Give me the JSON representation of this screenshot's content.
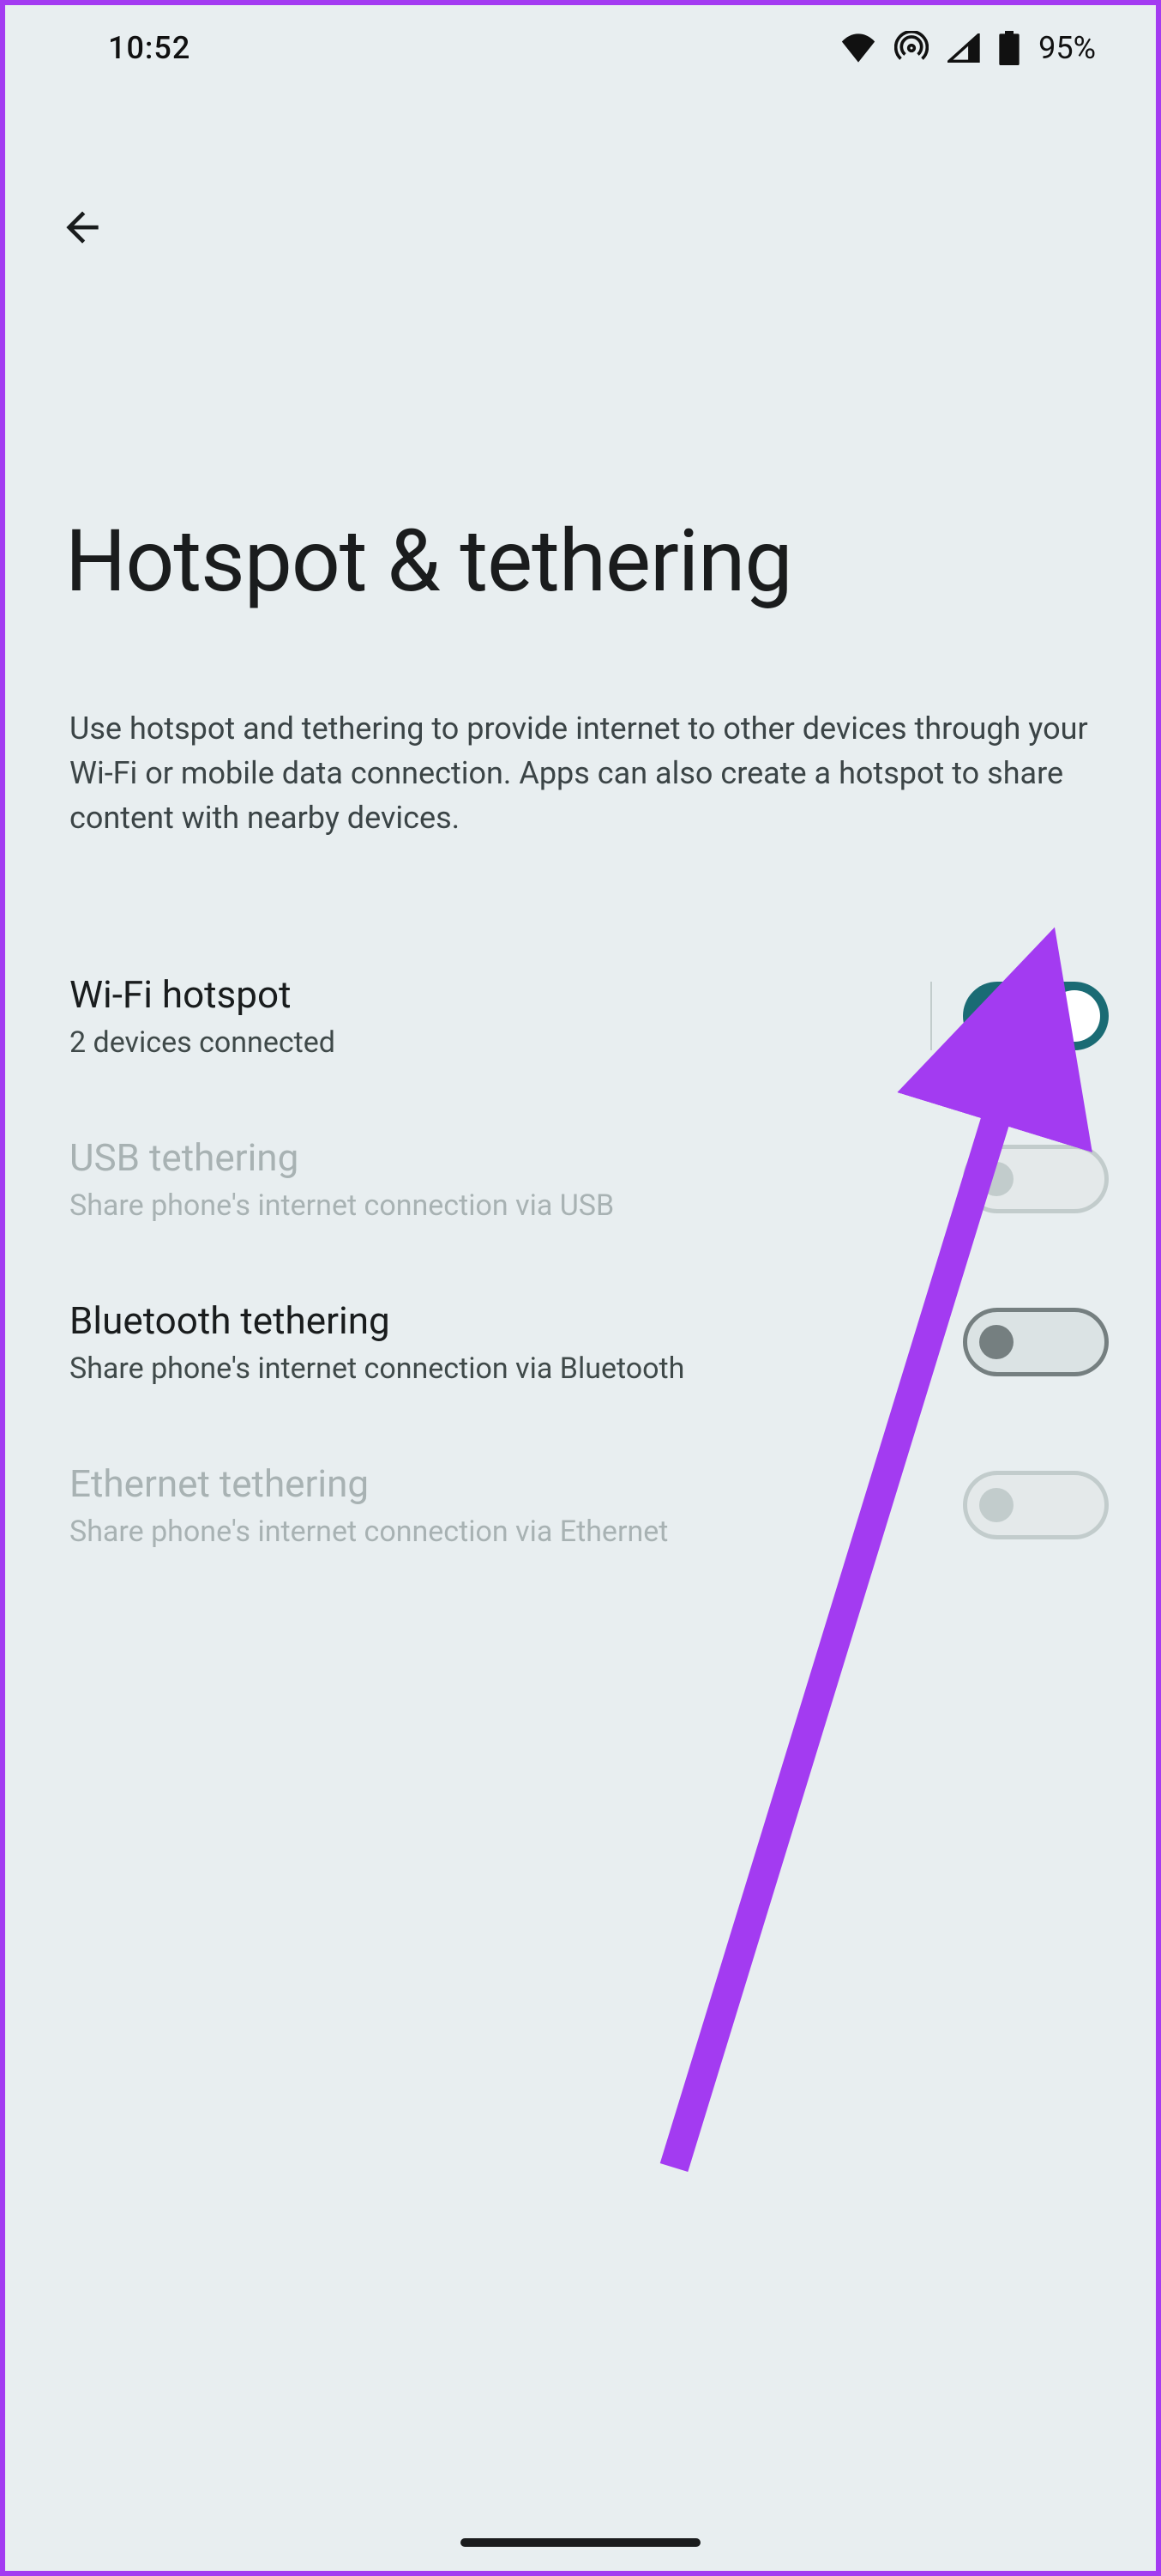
{
  "status": {
    "time": "10:52",
    "battery_text": "95%"
  },
  "page": {
    "title": "Hotspot & tethering",
    "description": "Use hotspot and tethering to provide internet to other devices through your Wi-Fi or mobile data connection. Apps can also create a hotspot to share content with nearby devices."
  },
  "settings": {
    "wifi_hotspot": {
      "title": "Wi-Fi hotspot",
      "subtitle": "2 devices connected",
      "enabled": true,
      "disabled_row": false
    },
    "usb_tethering": {
      "title": "USB tethering",
      "subtitle": "Share phone's internet connection via USB",
      "enabled": false,
      "disabled_row": true
    },
    "bluetooth_tethering": {
      "title": "Bluetooth tethering",
      "subtitle": "Share phone's internet connection via Bluetooth",
      "enabled": false,
      "disabled_row": false
    },
    "ethernet_tethering": {
      "title": "Ethernet tethering",
      "subtitle": "Share phone's internet connection via Ethernet",
      "enabled": false,
      "disabled_row": true
    }
  },
  "accent_color": "#1a6b74",
  "annotation_arrow_color": "#a33bf1"
}
